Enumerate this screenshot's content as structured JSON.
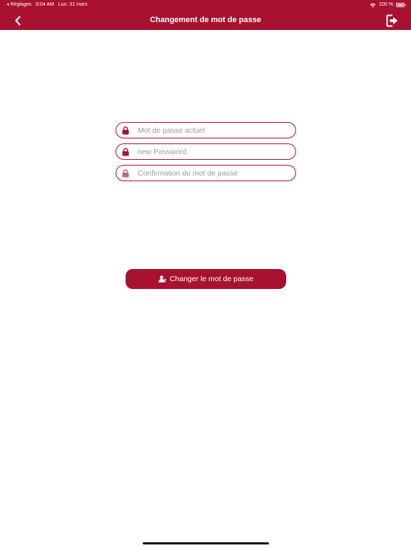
{
  "status_bar": {
    "back_app": "◂ Réglages",
    "time": "9:04 AM",
    "date": "Lun. 31 mars",
    "battery": "100 %"
  },
  "navbar": {
    "title": "Changement de mot de passe",
    "back_icon": "chevron-left-icon",
    "logout_icon": "logout-icon"
  },
  "form": {
    "current_password": {
      "value": "",
      "placeholder": "Mot de passe actuel"
    },
    "new_password": {
      "value": "",
      "placeholder": "new Password"
    },
    "confirm_password": {
      "value": "",
      "placeholder": "Confirmation du mot de passe"
    }
  },
  "submit": {
    "label": "Changer le mot de passe",
    "icon": "user-key-icon"
  },
  "colors": {
    "accent": "#a8122f",
    "background": "#ffffff",
    "placeholder": "#9a9a9a"
  }
}
